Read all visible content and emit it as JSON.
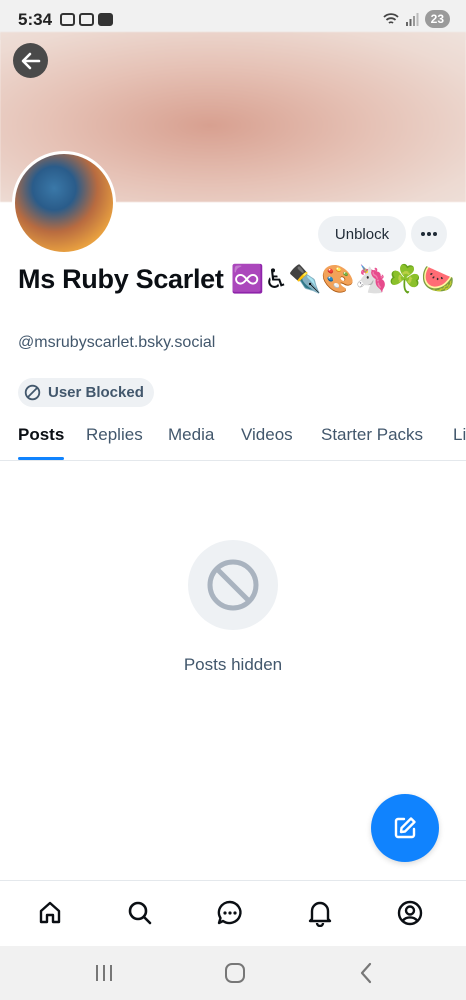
{
  "status_bar": {
    "time": "5:34",
    "battery": "23"
  },
  "profile": {
    "display_name": "Ms Ruby Scarlet ♾️♿✒️🎨🦄☘️🍉",
    "handle": "@msrubyscarlet.bsky.social",
    "unblock_label": "Unblock",
    "blocked_badge": "User Blocked"
  },
  "tabs": [
    "Posts",
    "Replies",
    "Media",
    "Videos",
    "Starter Packs",
    "Likes"
  ],
  "active_tab": "Posts",
  "empty_state": {
    "text": "Posts hidden"
  },
  "colors": {
    "accent": "#1083fe",
    "muted_text": "#42576c",
    "pill_bg": "#eef1f4"
  },
  "icons": {
    "status": [
      "screenshot-icon",
      "gmail-icon",
      "youtube-icon",
      "wifi-icon",
      "signal-icon"
    ],
    "bottom_nav": [
      "home-icon",
      "search-icon",
      "chat-icon",
      "bell-icon",
      "profile-icon"
    ],
    "system_nav": [
      "recents-icon",
      "home-circle-icon",
      "back-chevron-icon"
    ]
  }
}
